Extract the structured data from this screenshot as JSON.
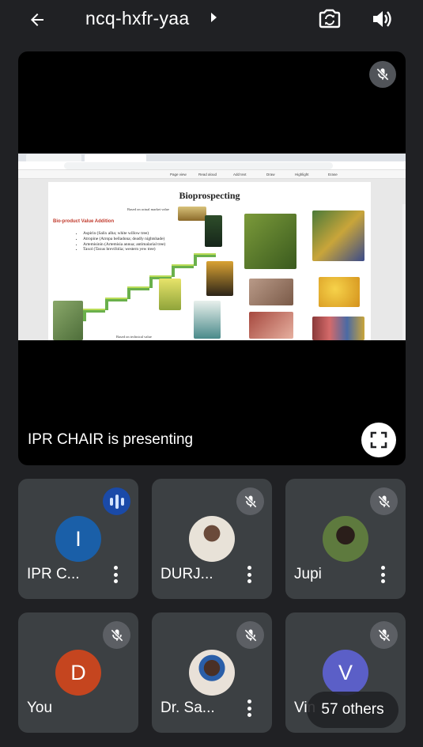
{
  "header": {
    "meeting_code": "ncq-hxfr-yaa",
    "back_icon": "arrow-left-icon",
    "switch_camera_icon": "switch-camera-icon",
    "speaker_icon": "volume-icon"
  },
  "presentation": {
    "presenter_label": "IPR CHAIR is presenting",
    "mic_state": "muted",
    "shared_content": {
      "pdf_toolbar": [
        "Page view",
        "Read aloud",
        "Add text",
        "Draw",
        "Highlight",
        "Erase"
      ],
      "slide_title": "Bioprospecting",
      "note_top": "Based on actual market value",
      "subtitle": "Bio-product Value Addition",
      "bullets": [
        "Aspirin (Salix alba; white willow tree)",
        "Atropine (Atropa belladona; deadly nightshade)",
        "Artemisinin (Artemisia annua; antimalarial tree)",
        "Taxol (Taxus brevifolia; western yew tree)"
      ],
      "note_bottom": "Based on technical value"
    }
  },
  "participants": [
    {
      "name": "IPR C...",
      "avatar_letter": "I",
      "avatar_color": "#1a5fa8",
      "status": "speaking"
    },
    {
      "name": "DURJ...",
      "avatar_letter": "",
      "avatar_color": "#c9b79c",
      "status": "muted"
    },
    {
      "name": "Jupi",
      "avatar_letter": "",
      "avatar_color": "#6b7a4a",
      "status": "muted"
    },
    {
      "name": "You",
      "avatar_letter": "D",
      "avatar_color": "#c5451f",
      "status": "muted"
    },
    {
      "name": "Dr. Sa...",
      "avatar_letter": "",
      "avatar_color": "#b7a79a",
      "status": "muted"
    },
    {
      "name": "Vin",
      "avatar_letter": "V",
      "avatar_color": "#5b5fc7",
      "status": "muted"
    }
  ],
  "others_label": "57 others",
  "colors": {
    "background": "#202124",
    "tile": "#3c4043",
    "speaking": "#1a4aa8"
  }
}
